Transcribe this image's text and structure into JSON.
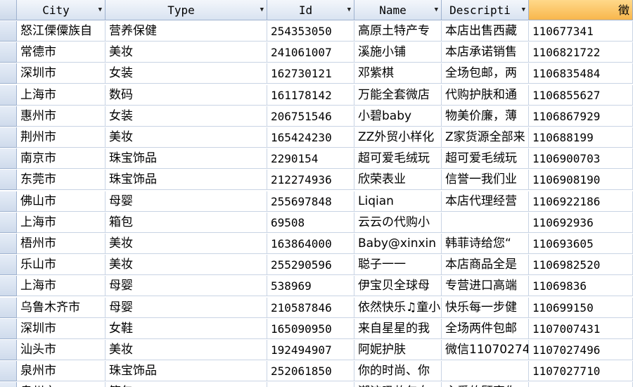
{
  "columns": [
    "City",
    "Type",
    "Id",
    "Name",
    "Descripti",
    "徵"
  ],
  "rows": [
    [
      "怒江傈僳族自",
      "营养保健",
      "254353050",
      "高原土特产专",
      "本店出售西藏",
      "110677341"
    ],
    [
      "常德市",
      "美妆",
      "241061007",
      "溪施小铺",
      "本店承诺销售",
      "1106821722"
    ],
    [
      "深圳市",
      "女装",
      "162730121",
      "邓紫棋",
      "全场包邮，两",
      "1106835484"
    ],
    [
      "上海市",
      "数码",
      "161178142",
      "万能全套微店",
      "代购护肤和通",
      "1106855627"
    ],
    [
      "惠州市",
      "女装",
      "206751546",
      "小碧baby",
      "物美价廉，薄",
      "1106867929"
    ],
    [
      "荆州市",
      "美妆",
      "165424230",
      "ZZ外贸小样化",
      "Z家货源全部来",
      "110688199"
    ],
    [
      "南京市",
      "珠宝饰品",
      "2290154",
      "超可爱毛绒玩",
      "超可爱毛绒玩",
      "1106900703"
    ],
    [
      "东莞市",
      "珠宝饰品",
      "212274936",
      "欣荣表业",
      "信誉一我们业",
      "1106908190"
    ],
    [
      "佛山市",
      "母婴",
      "255697848",
      "Liqian",
      "本店代理经营",
      "1106922186"
    ],
    [
      "上海市",
      "箱包",
      "69508",
      "云云の代购小",
      "",
      "110692936"
    ],
    [
      "梧州市",
      "美妆",
      "163864000",
      "Baby@xinxin",
      "韩菲诗给您“",
      "110693605"
    ],
    [
      "乐山市",
      "美妆",
      "255290596",
      "聪子一一",
      "本店商品全是",
      "1106982520"
    ],
    [
      "上海市",
      "母婴",
      "538969",
      "伊宝贝全球母",
      "专营进口高端",
      "11069836"
    ],
    [
      "乌鲁木齐市",
      "母婴",
      "210587846",
      "依然快乐♫童小",
      "快乐每一步健",
      "110699150"
    ],
    [
      "深圳市",
      "女鞋",
      "165090950",
      "来自星星的我",
      "全场两件包邮",
      "1107007431"
    ],
    [
      "汕头市",
      "美妆",
      "192494907",
      "阿妮护肤",
      "微信11070274",
      "1107027496"
    ],
    [
      "泉州市",
      "珠宝饰品",
      "252061850",
      "你的时尚、你",
      "",
      "1107027710"
    ],
    [
      "泉州市",
      "箱包",
      "",
      "潮流吸妆包女",
      "主爱的顾客你",
      ""
    ]
  ],
  "icons": {
    "dropdown": "dropdown-arrow-icon"
  }
}
